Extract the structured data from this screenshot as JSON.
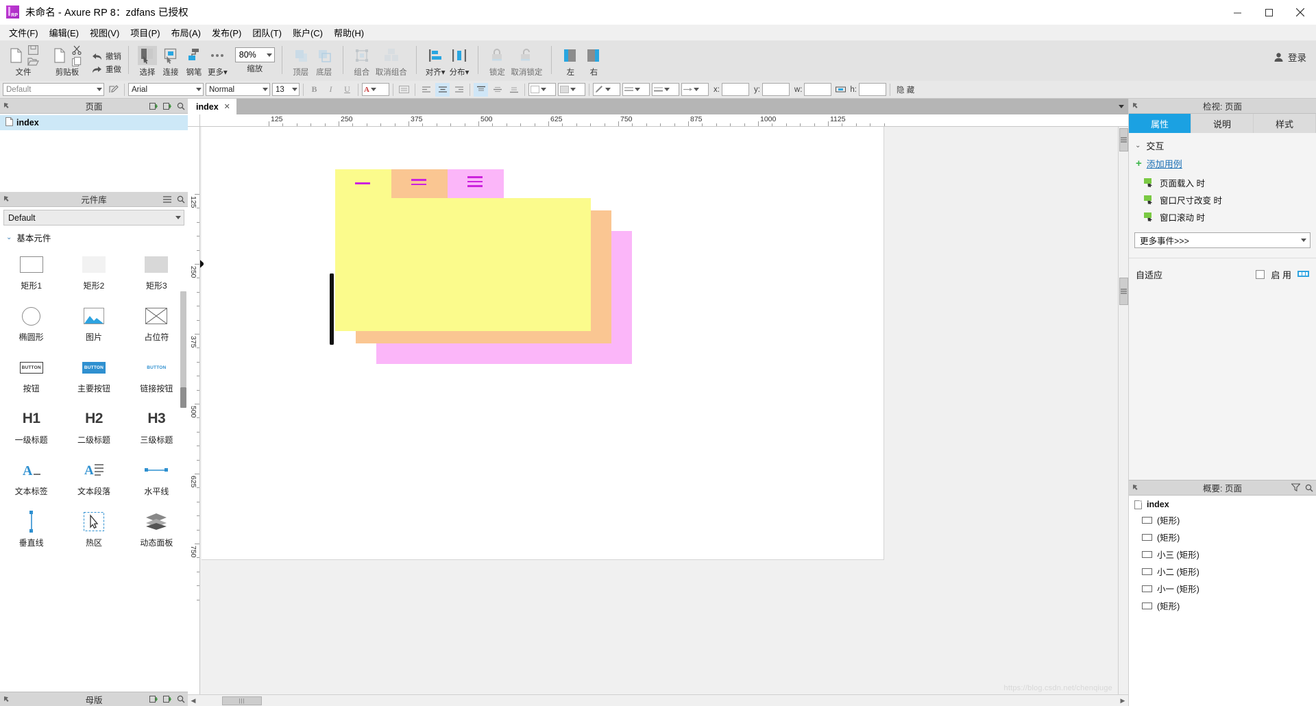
{
  "window": {
    "title": "未命名 - Axure RP 8：zdfans 已授权",
    "logo_text": "RP",
    "minimize": "−",
    "maximize": "▢",
    "close": "✕"
  },
  "menubar": {
    "items": [
      {
        "label": "文件(F)"
      },
      {
        "label": "编辑(E)"
      },
      {
        "label": "视图(V)"
      },
      {
        "label": "项目(P)"
      },
      {
        "label": "布局(A)"
      },
      {
        "label": "发布(P)"
      },
      {
        "label": "团队(T)"
      },
      {
        "label": "账户(C)"
      },
      {
        "label": "帮助(H)"
      }
    ]
  },
  "toolbar": {
    "file_label": "文件",
    "clipboard_label": "剪贴板",
    "undo_label": "撤销",
    "redo_label": "重做",
    "select_label": "选择",
    "connect_label": "连接",
    "pen_label": "钢笔",
    "more_label": "更多",
    "more_caret": "▾",
    "zoom_label": "缩放",
    "zoom_value": "80%",
    "top_label": "顶层",
    "bottom_label": "底层",
    "group_label": "组合",
    "ungroup_label": "取消组合",
    "align_label": "对齐",
    "align_caret": "▾",
    "distribute_label": "分布",
    "distribute_caret": "▾",
    "lock_label": "锁定",
    "unlock_label": "取消锁定",
    "left_label": "左",
    "right_label": "右",
    "login_label": "登录"
  },
  "formatbar": {
    "style_value": "Default",
    "font_value": "Arial",
    "weight_value": "Normal",
    "size_value": "13",
    "bold": "B",
    "italic": "I",
    "underline": "U",
    "more_text": "▾",
    "x_label": "x:",
    "y_label": "y:",
    "w_label": "w:",
    "h_label": "h:",
    "x_value": "",
    "y_value": "",
    "w_value": "",
    "h_value": "",
    "hide_label": "隐 藏"
  },
  "pages_panel": {
    "title": "页面",
    "items": [
      {
        "label": "index",
        "selected": true
      }
    ]
  },
  "library_panel": {
    "title": "元件库",
    "select_value": "Default",
    "select_caret": "▾",
    "section_label": "基本元件",
    "section_chevron": "⌄",
    "footer_title": "母版",
    "widgets": [
      {
        "label": "矩形1",
        "icon": "rectangle-1-icon"
      },
      {
        "label": "矩形2",
        "icon": "rectangle-2-icon"
      },
      {
        "label": "矩形3",
        "icon": "rectangle-3-icon"
      },
      {
        "label": "椭圆形",
        "icon": "ellipse-icon"
      },
      {
        "label": "图片",
        "icon": "image-icon"
      },
      {
        "label": "占位符",
        "icon": "placeholder-icon"
      },
      {
        "label": "按钮",
        "icon": "button-icon",
        "badge": "BUTTON"
      },
      {
        "label": "主要按钮",
        "icon": "primary-button-icon",
        "badge": "BUTTON"
      },
      {
        "label": "链接按钮",
        "icon": "link-button-icon",
        "badge": "BUTTON"
      },
      {
        "label": "一级标题",
        "icon": "heading-1-icon",
        "badge": "H1"
      },
      {
        "label": "二级标题",
        "icon": "heading-2-icon",
        "badge": "H2"
      },
      {
        "label": "三级标题",
        "icon": "heading-3-icon",
        "badge": "H3"
      },
      {
        "label": "文本标签",
        "icon": "text-label-icon"
      },
      {
        "label": "文本段落",
        "icon": "paragraph-icon"
      },
      {
        "label": "水平线",
        "icon": "horizontal-line-icon"
      },
      {
        "label": "垂直线",
        "icon": "vertical-line-icon"
      },
      {
        "label": "热区",
        "icon": "hotspot-icon"
      },
      {
        "label": "动态面板",
        "icon": "dynamic-panel-icon"
      }
    ]
  },
  "canvas": {
    "tab_label": "index",
    "tab_close": "✕",
    "tab_caret": "▾",
    "h_ruler_labels": [
      "125",
      "250",
      "375",
      "500",
      "625",
      "750",
      "875",
      "1000",
      "1125"
    ],
    "v_ruler_labels": [
      "125",
      "250",
      "375",
      "500",
      "625",
      "750"
    ],
    "watermark": "https://blog.csdn.net/chenqiuge",
    "shapes": [
      {
        "name": "tab-one",
        "color": "#fbfb8c",
        "glyph_lines": 1,
        "glyph_color": "#cc22dd"
      },
      {
        "name": "tab-two",
        "color": "#fac692",
        "glyph_lines": 2,
        "glyph_color": "#cc22dd"
      },
      {
        "name": "tab-three",
        "color": "#fbb6f9",
        "glyph_lines": 3,
        "glyph_color": "#cc22dd"
      },
      {
        "name": "panel-pink",
        "color": "#fbb6f9"
      },
      {
        "name": "panel-orange",
        "color": "#fac692"
      },
      {
        "name": "panel-yellow",
        "color": "#fbfb8c"
      }
    ],
    "hscroll_grip": "|||"
  },
  "inspector": {
    "title": "检视: 页面",
    "tabs": [
      {
        "label": "属性",
        "active": true
      },
      {
        "label": "说明",
        "active": false
      },
      {
        "label": "样式",
        "active": false
      }
    ],
    "interaction_label": "交互",
    "interaction_chevron": "⌄",
    "add_case_label": "添加用例",
    "add_case_plus": "+",
    "events": [
      {
        "label": "页面载入 时"
      },
      {
        "label": "窗口尺寸改变 时"
      },
      {
        "label": "窗口滚动 时"
      }
    ],
    "more_events_label": "更多事件>>>",
    "more_events_caret": "▾",
    "adaptive_label": "自适应",
    "enable_label": "启 用"
  },
  "outline": {
    "title": "概要: 页面",
    "root": "index",
    "items": [
      {
        "label": "(矩形)"
      },
      {
        "label": "(矩形)"
      },
      {
        "label": "小三 (矩形)"
      },
      {
        "label": "小二 (矩形)"
      },
      {
        "label": "小一 (矩形)"
      },
      {
        "label": "(矩形)"
      }
    ]
  },
  "colors": {
    "accent": "#1ba1e2",
    "yellow": "#fbfb8c",
    "orange": "#fac692",
    "pink": "#fbb6f9",
    "magenta": "#cc22dd",
    "link": "#1a6fb5",
    "green": "#3cb54a"
  }
}
